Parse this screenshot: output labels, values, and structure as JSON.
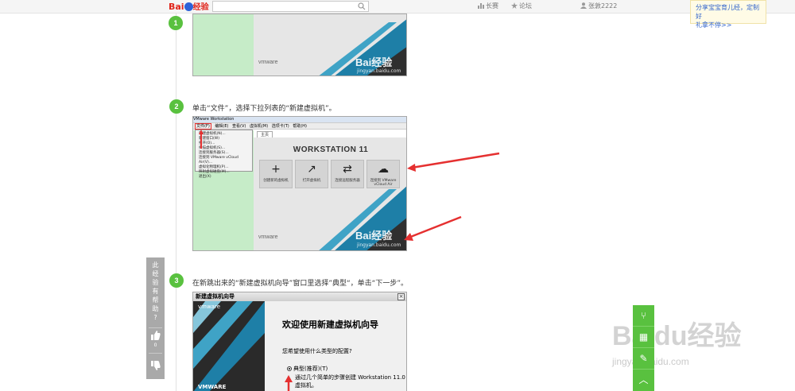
{
  "header": {
    "logo_text": "Bai",
    "logo_suffix": "经验",
    "search_placeholder": "",
    "nav": [
      {
        "icon": "bar-chart-icon",
        "label": "长赛"
      },
      {
        "icon": "star-icon",
        "label": "论坛"
      },
      {
        "icon": "user-icon",
        "label": "张敦2222"
      }
    ]
  },
  "promo": {
    "line1": "分享宝宝育儿经，定制好",
    "line2": "礼拿不停>>"
  },
  "steps": [
    {
      "number": "1",
      "text": ""
    },
    {
      "number": "2",
      "text": "单击“文件”，选择下拉列表的“新建虚拟机”。"
    },
    {
      "number": "3",
      "text": "在新跳出来的“新建虚拟机向导”窗口里选择”典型“，单击“下一步”。"
    }
  ],
  "screenshot1": {
    "vmware_mark": "vmware",
    "watermark": "Bai",
    "watermark_suffix": "经验",
    "watermark_url": "jingyan.baidu.com"
  },
  "screenshot2": {
    "title_bar": "VMware Workstation",
    "menus": [
      "文件(F)",
      "编辑(E)",
      "查看(V)",
      "虚拟机(M)",
      "选项卡(T)",
      "帮助(H)"
    ],
    "dropdown_items": [
      "新建虚拟机(N)...",
      "新建窗口(W)",
      "打开(O)...",
      "扫描虚拟机(S)...",
      "连接到服务器(S)...",
      "连接到 VMware vCloud Air(V)...",
      "虚拟化物理机(P)...",
      "映射虚拟磁盘(M)...",
      "退出(X)"
    ],
    "tab_label": "主页",
    "product_title": "WORKSTATION 11",
    "tiles": [
      {
        "glyph": "+",
        "label": "创建新的虚拟机"
      },
      {
        "glyph": "↗",
        "label": "打开虚拟机"
      },
      {
        "glyph": "⇄",
        "label": "连接远程服务器"
      },
      {
        "glyph": "☁",
        "label": "连接到 VMware vCloud Air"
      }
    ],
    "vmware_mark": "vmware",
    "watermark": "Bai",
    "watermark_suffix": "经验",
    "watermark_url": "jingyan.baidu.com"
  },
  "screenshot3": {
    "window_title": "新建虚拟机向导",
    "close_glyph": "×",
    "heading": "欢迎使用新建虚拟机向导",
    "question": "您希望使用什么类型的配置?",
    "option": "典型(推荐)(T)",
    "desc_line1": "通过几个简单的步骤创建 Workstation 11.0",
    "desc_line2": "虚拟机。",
    "vmware_mark": "vmware",
    "footer_mark": "VMWARE"
  },
  "feedback": {
    "question": "此经验有帮助?",
    "up_count": "0",
    "down_count": ""
  },
  "right_float": [
    {
      "icon": "share-icon",
      "glyph": "⑂"
    },
    {
      "icon": "qr-icon",
      "glyph": "▦"
    },
    {
      "icon": "comment-icon",
      "glyph": "✎"
    },
    {
      "icon": "back-to-top-icon",
      "glyph": "︿"
    }
  ],
  "page_watermark": {
    "text": "Bai",
    "suffix": "du经验",
    "url": "jingyan.baidu.com"
  },
  "colors": {
    "accent_green": "#59c13f",
    "baidu_red": "#e0251b",
    "baidu_blue": "#2d62d8",
    "annotation_red": "#e53030"
  }
}
